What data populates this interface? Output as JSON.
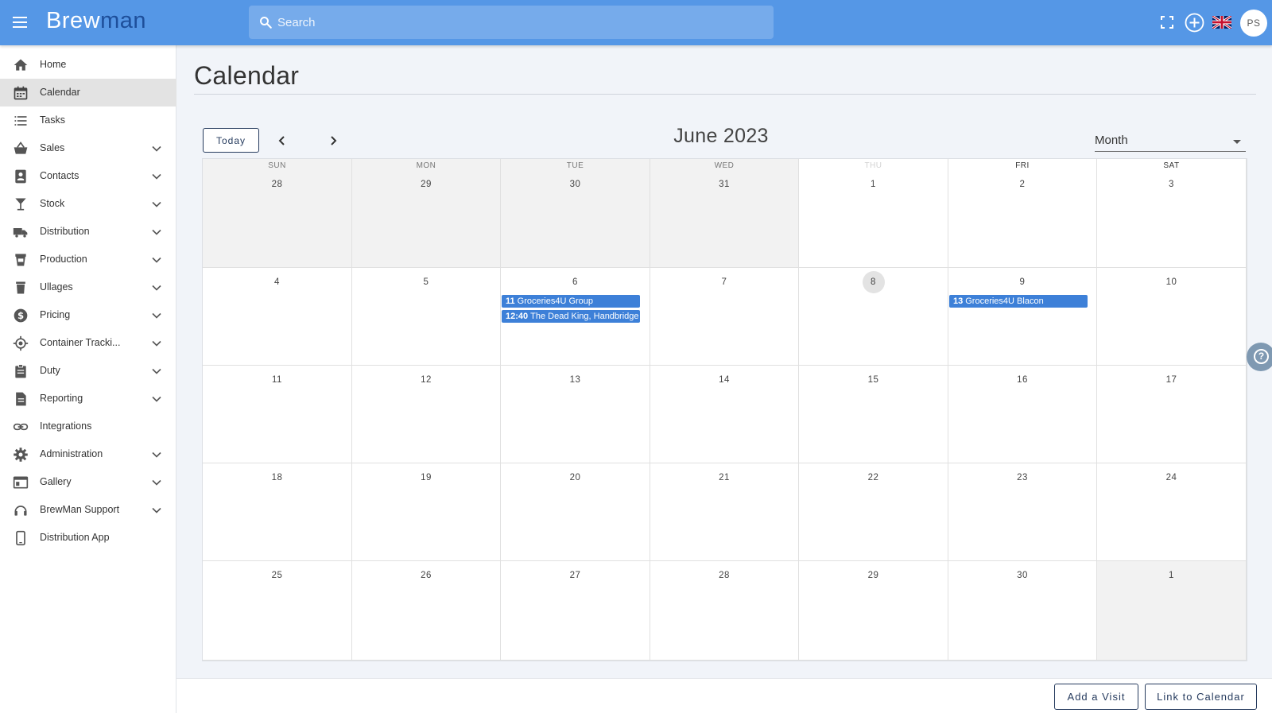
{
  "app": {
    "logo_main": "Brew",
    "logo_accent": "man",
    "search_placeholder": "Search",
    "avatar_initials": "PS",
    "language": "English (UK)"
  },
  "sidebar": {
    "items": [
      {
        "label": "Home",
        "icon": "home-icon",
        "expandable": false,
        "active": false
      },
      {
        "label": "Calendar",
        "icon": "calendar-icon",
        "expandable": false,
        "active": true
      },
      {
        "label": "Tasks",
        "icon": "list-icon",
        "expandable": false,
        "active": false
      },
      {
        "label": "Sales",
        "icon": "basket-icon",
        "expandable": true,
        "active": false
      },
      {
        "label": "Contacts",
        "icon": "contacts-icon",
        "expandable": true,
        "active": false
      },
      {
        "label": "Stock",
        "icon": "glass-icon",
        "expandable": true,
        "active": false
      },
      {
        "label": "Distribution",
        "icon": "truck-icon",
        "expandable": true,
        "active": false
      },
      {
        "label": "Production",
        "icon": "production-icon",
        "expandable": true,
        "active": false
      },
      {
        "label": "Ullages",
        "icon": "trash-icon",
        "expandable": true,
        "active": false
      },
      {
        "label": "Pricing",
        "icon": "dollar-icon",
        "expandable": true,
        "active": false
      },
      {
        "label": "Container Tracki...",
        "icon": "target-icon",
        "expandable": true,
        "active": false
      },
      {
        "label": "Duty",
        "icon": "clipboard-icon",
        "expandable": true,
        "active": false
      },
      {
        "label": "Reporting",
        "icon": "document-icon",
        "expandable": true,
        "active": false
      },
      {
        "label": "Integrations",
        "icon": "link-icon",
        "expandable": false,
        "active": false
      },
      {
        "label": "Administration",
        "icon": "gear-icon",
        "expandable": true,
        "active": false
      },
      {
        "label": "Gallery",
        "icon": "gallery-icon",
        "expandable": true,
        "active": false
      },
      {
        "label": "BrewMan Support",
        "icon": "support-icon",
        "expandable": true,
        "active": false
      },
      {
        "label": "Distribution App",
        "icon": "phone-icon",
        "expandable": false,
        "active": false
      }
    ]
  },
  "page": {
    "title": "Calendar"
  },
  "calendar": {
    "today_label": "Today",
    "month_title": "June 2023",
    "view": "Month",
    "weekdays": [
      "SUN",
      "MON",
      "TUE",
      "WED",
      "THU",
      "FRI",
      "SAT"
    ],
    "weeks": [
      [
        {
          "day": "28",
          "outside": true
        },
        {
          "day": "29",
          "outside": true
        },
        {
          "day": "30",
          "outside": true
        },
        {
          "day": "31",
          "outside": true
        },
        {
          "day": "1"
        },
        {
          "day": "2"
        },
        {
          "day": "3"
        }
      ],
      [
        {
          "day": "4"
        },
        {
          "day": "5"
        },
        {
          "day": "6",
          "events": [
            {
              "time": "11",
              "title": "Groceries4U Group"
            },
            {
              "time": "12:40",
              "title": "The Dead King, Handbridge"
            }
          ]
        },
        {
          "day": "7"
        },
        {
          "day": "8",
          "today": true
        },
        {
          "day": "9",
          "events": [
            {
              "time": "13",
              "title": "Groceries4U Blacon"
            }
          ]
        },
        {
          "day": "10"
        }
      ],
      [
        {
          "day": "11"
        },
        {
          "day": "12"
        },
        {
          "day": "13"
        },
        {
          "day": "14"
        },
        {
          "day": "15"
        },
        {
          "day": "16"
        },
        {
          "day": "17"
        }
      ],
      [
        {
          "day": "18"
        },
        {
          "day": "19"
        },
        {
          "day": "20"
        },
        {
          "day": "21"
        },
        {
          "day": "22"
        },
        {
          "day": "23"
        },
        {
          "day": "24"
        }
      ],
      [
        {
          "day": "25"
        },
        {
          "day": "26"
        },
        {
          "day": "27"
        },
        {
          "day": "28"
        },
        {
          "day": "29"
        },
        {
          "day": "30"
        },
        {
          "day": "1",
          "outside": true
        }
      ]
    ]
  },
  "actions": {
    "add_visit": "Add a Visit",
    "link_calendar": "Link to Calendar"
  },
  "colors": {
    "topbar": "#5597e6",
    "event": "#3d80d8",
    "button_border": "#263b5e"
  }
}
